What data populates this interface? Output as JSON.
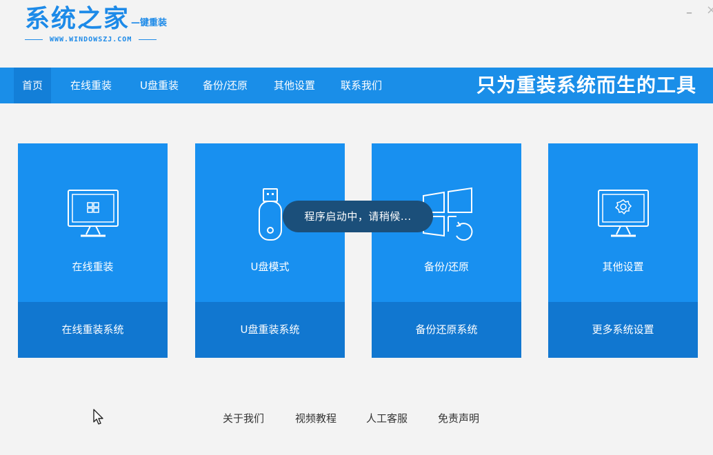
{
  "header": {
    "logo_main": "系统之家",
    "logo_sub": "—键重装",
    "logo_url": "WWW.WINDOWSZJ.COM",
    "minimize_glyph": "–",
    "close_glyph": "×"
  },
  "nav": {
    "items": [
      {
        "label": "首页",
        "active": true
      },
      {
        "label": "在线重装"
      },
      {
        "label": "U盘重装"
      },
      {
        "label": "备份/还原"
      },
      {
        "label": "其他设置"
      },
      {
        "label": "联系我们"
      }
    ],
    "slogan": "只为重装系统而生的工具"
  },
  "cards": [
    {
      "title": "在线重装",
      "action": "在线重装系统",
      "icon": "windows-monitor-icon"
    },
    {
      "title": "U盘模式",
      "action": "U盘重装系统",
      "icon": "usb-drive-icon"
    },
    {
      "title": "备份/还原",
      "action": "备份还原系统",
      "icon": "windows-restore-icon"
    },
    {
      "title": "其他设置",
      "action": "更多系统设置",
      "icon": "settings-monitor-icon"
    }
  ],
  "toast": {
    "text": "程序启动中，请稍候..."
  },
  "footer": {
    "links": [
      "关于我们",
      "视频教程",
      "人工客服",
      "免责声明"
    ]
  },
  "colors": {
    "brand_blue": "#1a8ee8",
    "card_blue": "#1890f0",
    "card_dark_blue": "#1177d0",
    "toast_bg": "#1b4f7a"
  }
}
